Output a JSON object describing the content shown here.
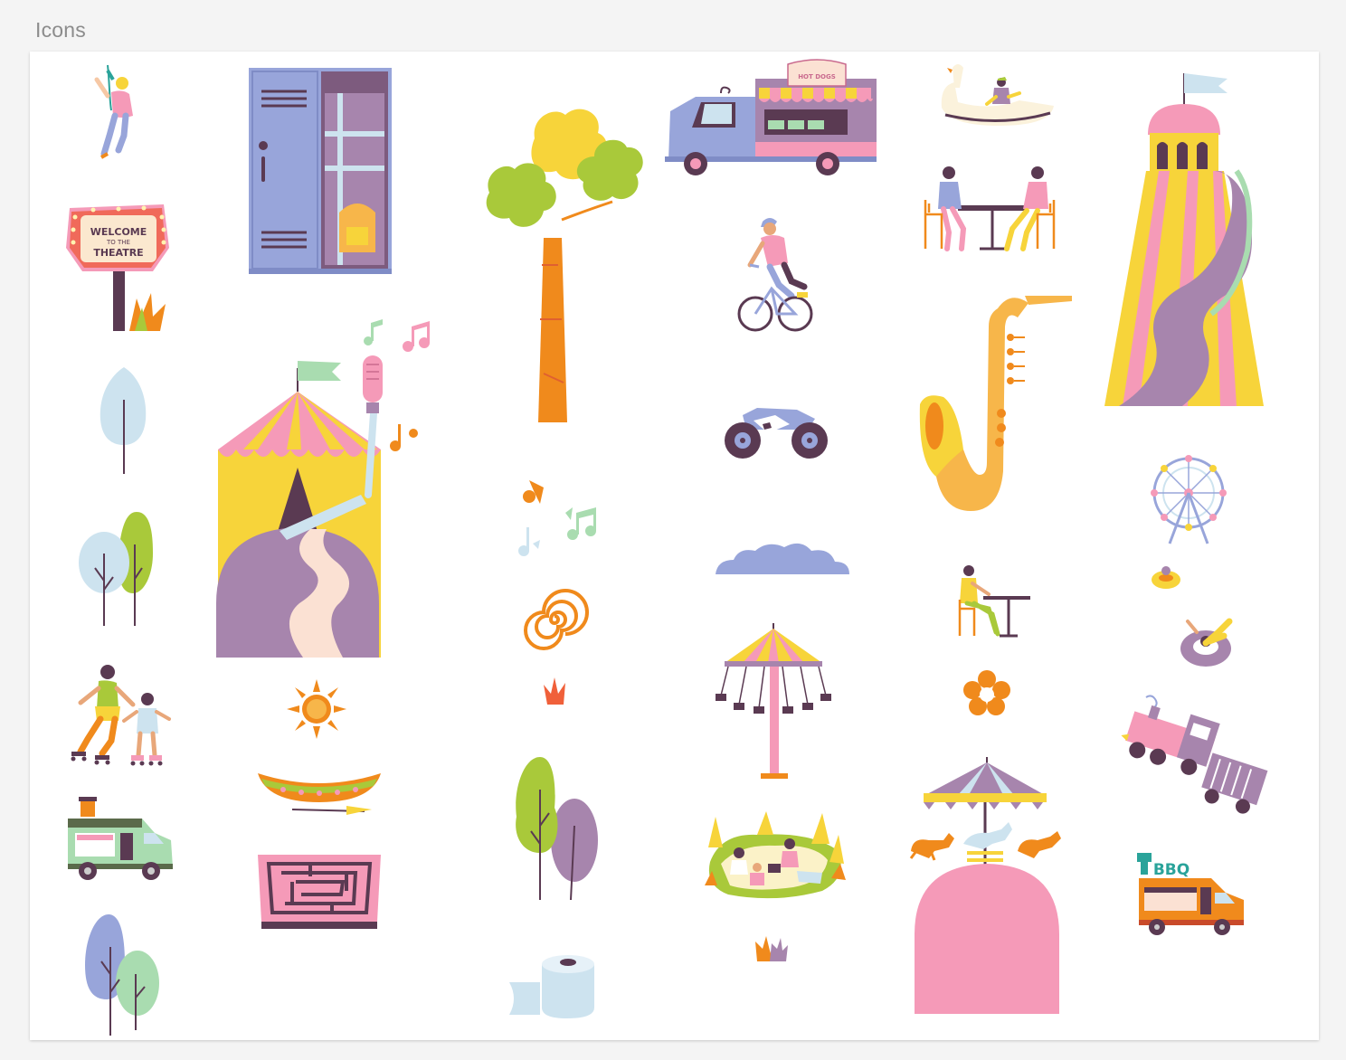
{
  "section": {
    "title": "Icons"
  },
  "illustrations": {
    "theatre_sign": {
      "line1": "WELCOME",
      "line2": "TO THE",
      "line3": "THEATRE"
    },
    "hotdog_truck": {
      "sign": "HOT DOGS"
    },
    "bbq_truck": {
      "sign": "BBQ"
    }
  },
  "colors": {
    "canvas_bg": "#ffffff",
    "page_bg": "#f4f4f4",
    "pink": "#f59ab8",
    "yellow": "#f7d43a",
    "purple": "#a785ad",
    "lavender": "#98a5da",
    "orange": "#f08a1c",
    "green": "#a9c93a",
    "mint": "#a9dcb0",
    "light_blue": "#cde3ef"
  }
}
